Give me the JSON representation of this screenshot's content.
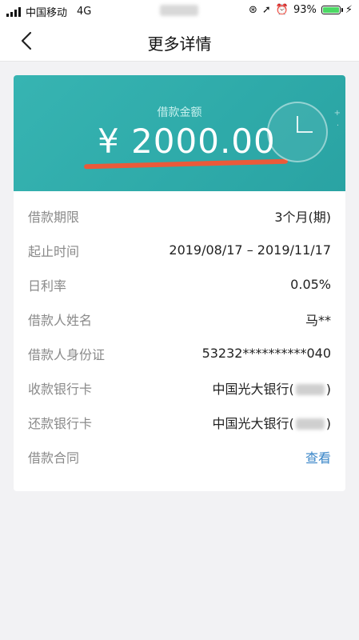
{
  "status": {
    "carrier": "中国移动",
    "network": "4G",
    "battery": "93%"
  },
  "nav": {
    "title": "更多详情"
  },
  "loan": {
    "amount_label": "借款金额",
    "amount": "¥ 2000.00"
  },
  "details": [
    {
      "label": "借款期限",
      "value": "3个月(期)"
    },
    {
      "label": "起止时间",
      "value": "2019/08/17 – 2019/11/17"
    },
    {
      "label": "日利率",
      "value": "0.05%"
    },
    {
      "label": "借款人姓名",
      "value": "马**"
    },
    {
      "label": "借款人身份证",
      "value": "53232**********040"
    },
    {
      "label": "收款银行卡",
      "value": "中国光大银行(",
      "suffix": ")"
    },
    {
      "label": "还款银行卡",
      "value": "中国光大银行(",
      "suffix": ")"
    },
    {
      "label": "借款合同",
      "value": "查看"
    }
  ],
  "colors": {
    "hero": "#2eaaa9",
    "underline": "#ea5a3a",
    "link": "#3a86c8"
  },
  "icons": [
    "back-arrow-icon",
    "clock-icon",
    "battery-icon",
    "signal-icon",
    "location-icon",
    "alarm-icon",
    "charging-icon"
  ]
}
